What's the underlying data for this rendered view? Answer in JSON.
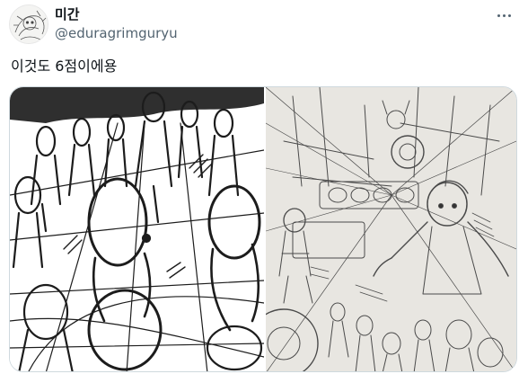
{
  "tweet": {
    "display_name": "미간",
    "handle": "@eduragrimguryu",
    "text": "이것도 6점이에용",
    "more_icon": "more-horizontal-icon"
  },
  "media": {
    "images": [
      {
        "description_name": "sketch-image-crowd"
      },
      {
        "description_name": "sketch-image-machine-room"
      }
    ]
  }
}
